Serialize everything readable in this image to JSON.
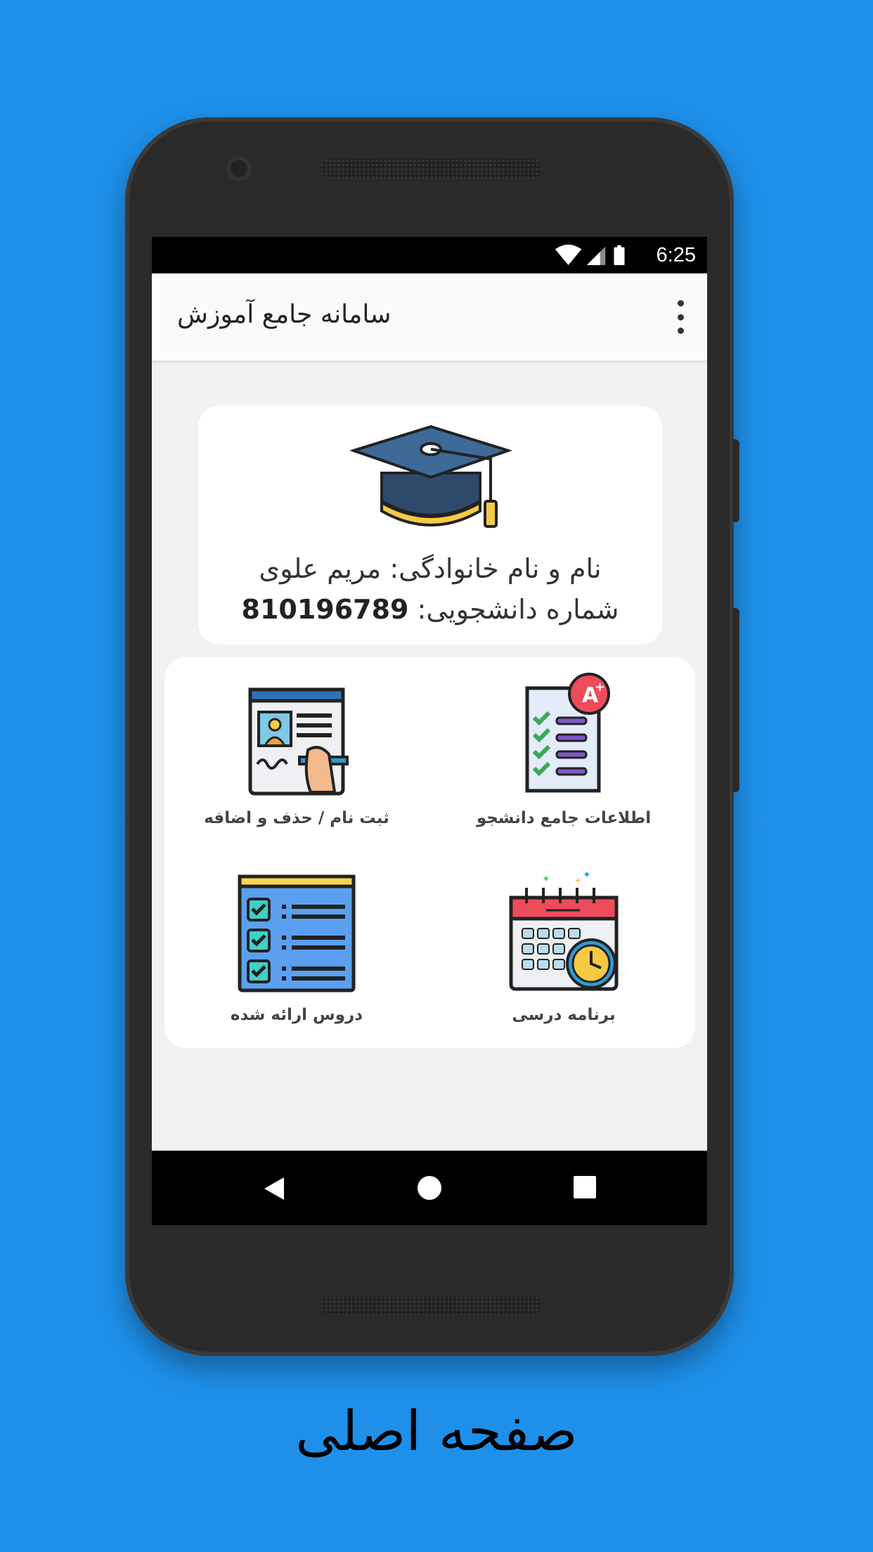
{
  "status_bar": {
    "time": "6:25",
    "icons": [
      "wifi-icon",
      "cell-signal-icon",
      "battery-icon"
    ]
  },
  "app_bar": {
    "title": "سامانه جامع آموزش",
    "menu_icon": "overflow-menu-icon"
  },
  "profile": {
    "name_line": "نام و نام خانوادگی: مریم علوی",
    "id_label": "شماره دانشجویی: ",
    "id_value": "810196789",
    "icon": "graduation-cap-icon"
  },
  "menu": {
    "items": [
      {
        "label": "اطلاعات جامع دانشجو",
        "icon": "report-card-icon"
      },
      {
        "label": "ثبت نام / حذف و اضافه",
        "icon": "registration-form-icon"
      },
      {
        "label": "برنامه درسی",
        "icon": "calendar-clock-icon"
      },
      {
        "label": "دروس ارائه شده",
        "icon": "checklist-icon"
      }
    ]
  },
  "nav_bar": {
    "icons": [
      "back-icon",
      "home-icon",
      "recents-icon"
    ]
  },
  "caption": "صفحه اصلی",
  "colors": {
    "background": "#1e90ea",
    "screen": "#f2f2f2",
    "card": "#ffffff",
    "phone": "#2a2a2a"
  }
}
